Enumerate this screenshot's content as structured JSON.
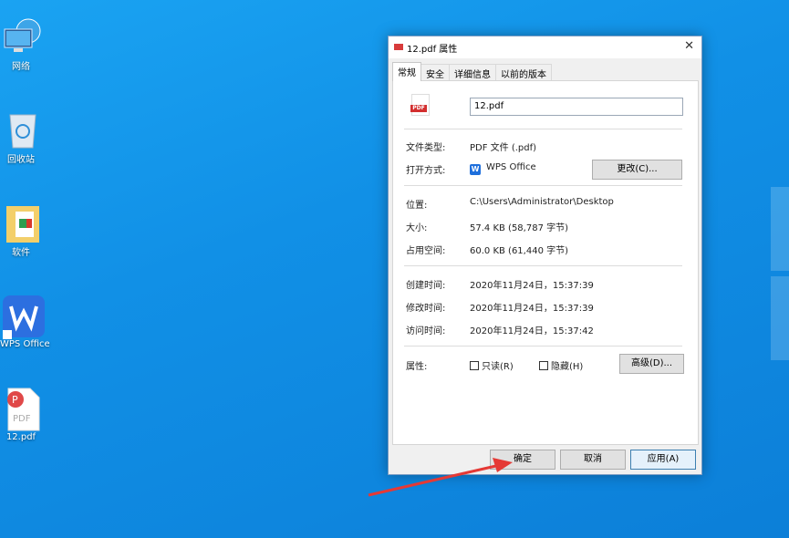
{
  "desktop": {
    "icons": [
      {
        "label": "网络",
        "icon": "network-icon"
      },
      {
        "label": "回收站",
        "icon": "recycle-bin-icon"
      },
      {
        "label": "软件",
        "icon": "folder-icon"
      },
      {
        "label": "WPS Office",
        "icon": "wps-office-icon"
      },
      {
        "label": "12.pdf",
        "icon": "pdf-file-icon"
      }
    ]
  },
  "dialog": {
    "title": "12.pdf 属性",
    "close_label": "✕",
    "tabs": [
      "常规",
      "安全",
      "详细信息",
      "以前的版本"
    ],
    "filename": "12.pdf",
    "pdf_badge": "PDF",
    "file_type_label": "文件类型:",
    "file_type_value": "PDF 文件 (.pdf)",
    "open_with_label": "打开方式:",
    "open_with_value": "WPS Office",
    "wps_glyph": "W",
    "change_button": "更改(C)...",
    "location_label": "位置:",
    "location_value": "C:\\Users\\Administrator\\Desktop",
    "size_label": "大小:",
    "size_value": "57.4 KB (58,787 字节)",
    "disk_size_label": "占用空间:",
    "disk_size_value": "60.0 KB (61,440 字节)",
    "created_label": "创建时间:",
    "created_value": "2020年11月24日，15:37:39",
    "modified_label": "修改时间:",
    "modified_value": "2020年11月24日，15:37:39",
    "accessed_label": "访问时间:",
    "accessed_value": "2020年11月24日，15:37:42",
    "attributes_label": "属性:",
    "readonly_label": "只读(R)",
    "hidden_label": "隐藏(H)",
    "advanced_button": "高级(D)...",
    "ok_button": "确定",
    "cancel_button": "取消",
    "apply_button": "应用(A)"
  }
}
